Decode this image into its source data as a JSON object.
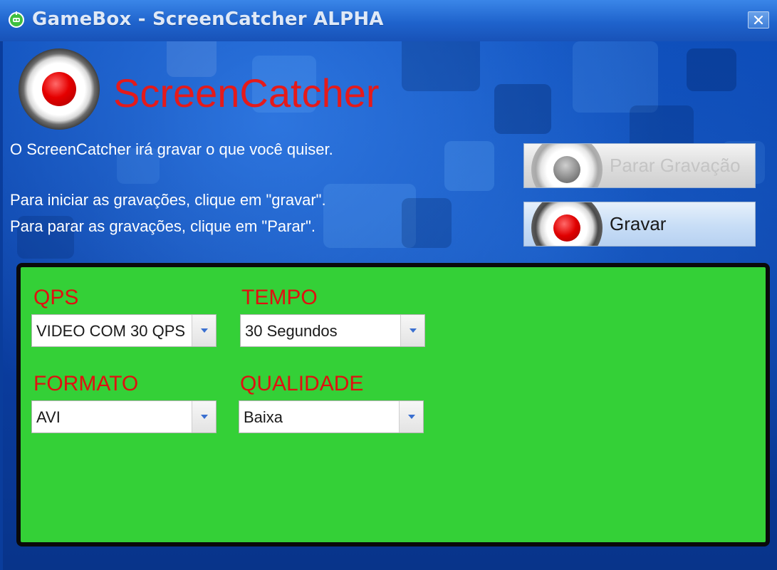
{
  "window": {
    "title": "GameBox - ScreenCatcher ALPHA"
  },
  "header": {
    "logo_text": "ScreenCatcher",
    "intro": "O ScreenCatcher irá gravar o que você quiser.",
    "instruction_start": "Para iniciar as gravações, clique em \"gravar\".",
    "instruction_stop": "Para parar as gravações, clique em \"Parar\"."
  },
  "buttons": {
    "stop_label": "Parar Gravação",
    "record_label": "Gravar"
  },
  "settings": {
    "qps": {
      "label": "QPS",
      "value": "VIDEO COM 30 QPS"
    },
    "tempo": {
      "label": "TEMPO",
      "value": "30 Segundos"
    },
    "formato": {
      "label": "FORMATO",
      "value": "AVI"
    },
    "qualidade": {
      "label": "QUALIDADE",
      "value": "Baixa"
    }
  },
  "colors": {
    "accent_red": "#e51a1a",
    "panel_green": "#34d037",
    "titlebar_blue": "#1f63cc"
  },
  "icons": [
    "app-icon",
    "close-icon",
    "record-icon",
    "stop-icon",
    "dropdown-arrow-icon"
  ]
}
